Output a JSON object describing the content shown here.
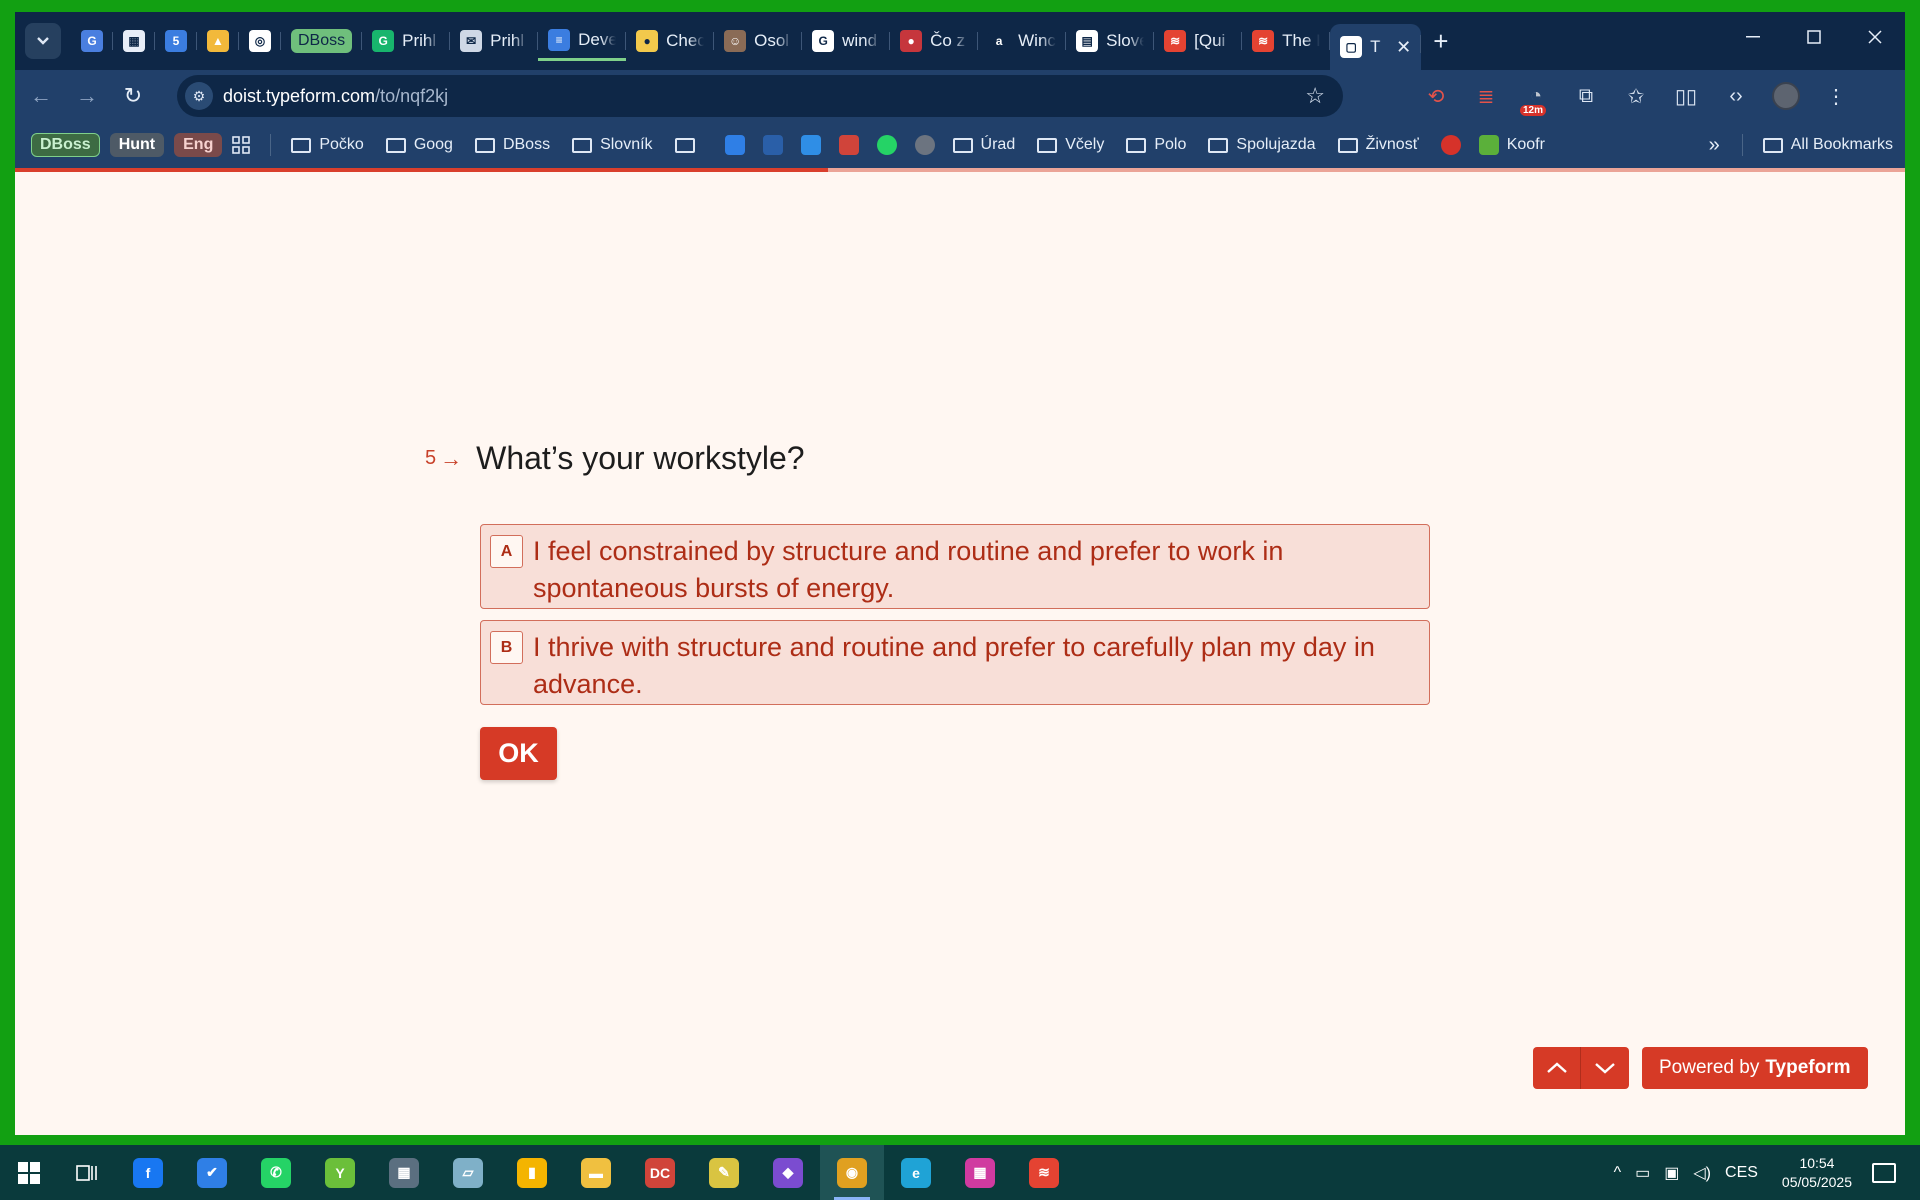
{
  "browser": {
    "tabs": [
      {
        "title": "",
        "icon": "google-translate-icon",
        "color": "#4a7fe0",
        "glyph": "G"
      },
      {
        "title": "",
        "icon": "site-icon",
        "color": "#e8eef8",
        "glyph": "▦"
      },
      {
        "title": "",
        "icon": "calendar-icon",
        "color": "#3b7de0",
        "glyph": "5"
      },
      {
        "title": "",
        "icon": "google-drive-icon",
        "color": "#f2b93b",
        "glyph": "▲"
      },
      {
        "title": "",
        "icon": "openai-icon",
        "color": "#ffffff",
        "glyph": "◎"
      },
      {
        "title": "DBoss",
        "icon": "dboss-badge",
        "pill": true
      },
      {
        "title": "Prihl",
        "icon": "grammarly-icon",
        "color": "#18b56d",
        "glyph": "G"
      },
      {
        "title": "Prihl",
        "icon": "chat-icon",
        "color": "#cfd8e6",
        "glyph": "✉"
      },
      {
        "title": "Deve",
        "icon": "docs-icon",
        "color": "#3b7de0",
        "glyph": "≡",
        "underline": true
      },
      {
        "title": "Chec",
        "icon": "egg-icon",
        "color": "#f2c94c",
        "glyph": "●"
      },
      {
        "title": "Osol",
        "icon": "profile-photo-icon",
        "color": "#8a6b56",
        "glyph": "☺"
      },
      {
        "title": "wind",
        "icon": "google-icon",
        "color": "#ffffff",
        "glyph": "G"
      },
      {
        "title": "Čo z",
        "icon": "serbia-flag-icon",
        "color": "#c6363c",
        "glyph": "●"
      },
      {
        "title": "Winc",
        "icon": "amazon-icon",
        "color": "#0e2747",
        "glyph": "a"
      },
      {
        "title": "Slove",
        "icon": "document-icon",
        "color": "#ffffff",
        "glyph": "▤"
      },
      {
        "title": "[Qui",
        "icon": "todoist-icon",
        "color": "#e44332",
        "glyph": "≋"
      },
      {
        "title": "The I",
        "icon": "todoist-icon",
        "color": "#e44332",
        "glyph": "≋"
      },
      {
        "title": "T",
        "icon": "typeform-icon",
        "color": "#ffffff",
        "glyph": "▢",
        "active": true
      }
    ],
    "new_tab": "+",
    "url_host": "doist.typeform.com",
    "url_path": "/to/nqf2kj",
    "ext_badge": "12m",
    "bookmark_pills": [
      {
        "label": "DBoss",
        "bg": "#3d6b43",
        "fg": "#c9f0cf",
        "border": "#7fd08a"
      },
      {
        "label": "Hunt",
        "bg": "#4e5a66",
        "fg": "#ffffff",
        "border": "#4e5a66"
      },
      {
        "label": "Eng",
        "bg": "#7a4a4a",
        "fg": "#f7d2cf",
        "border": "#7a4a4a"
      }
    ],
    "bookmarks_a": [
      "Počko",
      "Goog",
      "DBoss",
      "Slovník"
    ],
    "bookmarks_b": [
      "Úrad",
      "Včely",
      "Polo",
      "Spolujazda",
      "Živnosť"
    ],
    "bookmark_koofr": "Koofr",
    "all_bookmarks": "All Bookmarks",
    "overflow": "»"
  },
  "form": {
    "progress_fraction": 0.43,
    "question_number": "5",
    "question": "What’s your workstyle?",
    "options": [
      {
        "key": "A",
        "text": "I feel constrained by structure and routine and prefer to work in spontaneous bursts of energy."
      },
      {
        "key": "B",
        "text": "I thrive with structure and routine and prefer to carefully plan my day in advance."
      }
    ],
    "ok_label": "OK",
    "powered_prefix": "Powered by",
    "powered_brand": "Typeform",
    "accent": "#d63a26"
  },
  "taskbar": {
    "apps": [
      {
        "name": "facebook",
        "color": "#1877f2",
        "glyph": "f"
      },
      {
        "name": "todo",
        "color": "#2f7fe6",
        "glyph": "✔"
      },
      {
        "name": "whatsapp",
        "color": "#25d366",
        "glyph": "✆"
      },
      {
        "name": "y-app",
        "color": "#6bbf3a",
        "glyph": "Y"
      },
      {
        "name": "calculator",
        "color": "#5b6f80",
        "glyph": "▦"
      },
      {
        "name": "notebook",
        "color": "#7fb0c8",
        "glyph": "▱"
      },
      {
        "name": "keep",
        "color": "#f4b400",
        "glyph": "▮"
      },
      {
        "name": "file-explorer",
        "color": "#f0c040",
        "glyph": "▬"
      },
      {
        "name": "dc-app",
        "color": "#d0443a",
        "glyph": "DC"
      },
      {
        "name": "sticky-app",
        "color": "#d9c441",
        "glyph": "✎"
      },
      {
        "name": "visual-studio",
        "color": "#7b4cd0",
        "glyph": "◆"
      },
      {
        "name": "chrome",
        "color": "#e0a020",
        "glyph": "◉",
        "active": true
      },
      {
        "name": "edge",
        "color": "#1fa3d6",
        "glyph": "e"
      },
      {
        "name": "grid-app",
        "color": "#d03aa0",
        "glyph": "▦"
      },
      {
        "name": "todoist",
        "color": "#e44332",
        "glyph": "≋"
      }
    ],
    "lang": "CES",
    "time": "10:54",
    "date": "05/05/2025"
  }
}
